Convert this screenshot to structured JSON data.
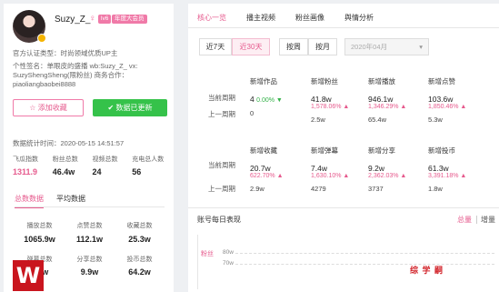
{
  "profile": {
    "name": "Suzy_Z_",
    "gender_icon": "♀",
    "level": "lv6",
    "vip": "年度大会员",
    "cert_type": "官方认证类型：",
    "cert_desc": "时尚领域优质UP主",
    "sig_line1": "个性签名：单眼皮的盛播 wb:Suzy_Z_ vx:",
    "sig_line2": "SuzyShengSheng(限粉丝) 商务合作：",
    "sig_line3": "piaoliangbaobei8888",
    "fav_button": "添加收藏",
    "update_button": "数据已更新"
  },
  "stats": {
    "time_label": "数据统计时间：",
    "time": "2020-05-15 14:51:57",
    "headers": [
      "飞瓜指数",
      "粉丝总数",
      "视频总数",
      "充电总人数"
    ],
    "values": [
      "1311.9",
      "46.4w",
      "24",
      "56"
    ],
    "subtabs": [
      "总数数据",
      "平均数据"
    ],
    "sum_headers1": [
      "播放总数",
      "点赞总数",
      "收藏总数"
    ],
    "sum_values1": [
      "1065.9w",
      "112.1w",
      "25.3w"
    ],
    "sum_headers2": [
      "弹幕总数",
      "分享总数",
      "投币总数"
    ],
    "sum_values2": [
      "2.2w",
      "9.9w",
      "64.2w"
    ]
  },
  "tabs": [
    "核心一览",
    "播主视频",
    "粉丝画像",
    "舆情分析"
  ],
  "range": {
    "btn7": "近7天",
    "btn30": "近30天",
    "week": "按周",
    "month": "按月",
    "month_select": "2020年04月",
    "caret": "▾"
  },
  "rows": {
    "current": "当前周期",
    "previous": "上一周期"
  },
  "metrics_top": [
    {
      "title": "新增作品",
      "value": "4",
      "change": "0.00%",
      "dir": "down",
      "prev": "0"
    },
    {
      "title": "新增粉丝",
      "value": "41.8w",
      "change": "1,578.06%",
      "dir": "up",
      "prev": "2.5w"
    },
    {
      "title": "新增播放",
      "value": "946.1w",
      "change": "1,346.29%",
      "dir": "up",
      "prev": "65.4w"
    },
    {
      "title": "新增点赞",
      "value": "103.6w",
      "change": "1,850.46%",
      "dir": "up",
      "prev": "5.3w"
    }
  ],
  "metrics_bottom": [
    {
      "title": "新增收藏",
      "value": "20.7w",
      "change": "622.70%",
      "dir": "up",
      "prev": "2.9w"
    },
    {
      "title": "新增弹幕",
      "value": "7.4w",
      "change": "1,630.10%",
      "dir": "up",
      "prev": "4279"
    },
    {
      "title": "新增分享",
      "value": "9.2w",
      "change": "2,362.03%",
      "dir": "up",
      "prev": "3737"
    },
    {
      "title": "新增投币",
      "value": "61.3w",
      "change": "3,391.18%",
      "dir": "up",
      "prev": "1.8w"
    }
  ],
  "daily": {
    "title": "账号每日表现",
    "total": "总量",
    "increment": "增量",
    "series": "粉丝",
    "ticks": [
      "80w",
      "70w"
    ]
  },
  "logo_text": "W",
  "watermark": "综 学 嗣",
  "colors": {
    "accent": "#e65a8d",
    "green": "#35c24a"
  }
}
